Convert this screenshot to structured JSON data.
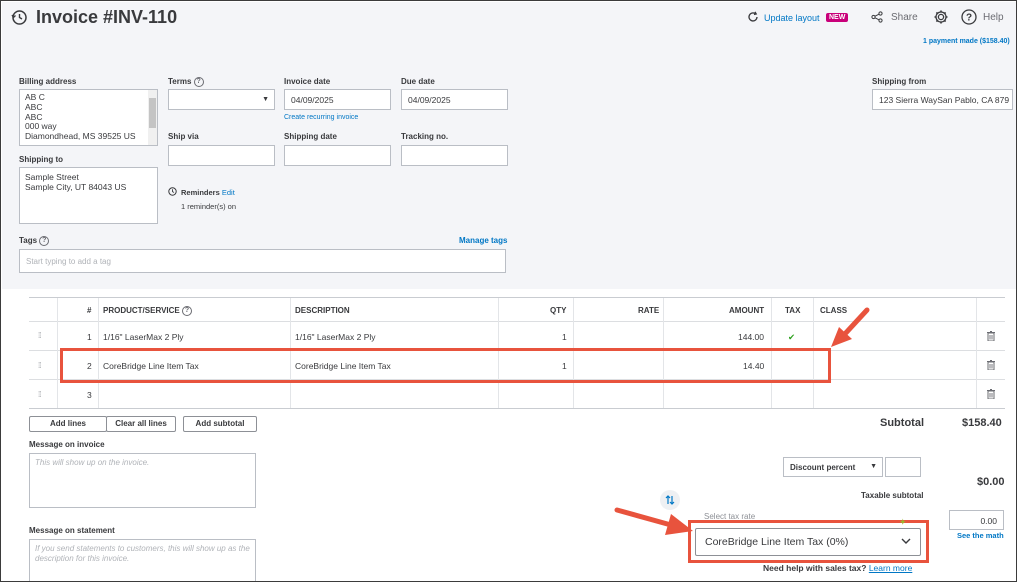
{
  "header": {
    "title": "Invoice #INV-110",
    "update_layout": "Update layout",
    "new_badge": "NEW",
    "share": "Share",
    "help": "Help",
    "payment_made": "1 payment made ($158.40)"
  },
  "form": {
    "billing_address_label": "Billing address",
    "billing_address_lines": [
      "AB C",
      "ABC",
      "ABC",
      "000 way",
      "Diamondhead, MS  39525 US"
    ],
    "terms_label": "Terms",
    "terms_value": "",
    "invoice_date_label": "Invoice date",
    "invoice_date_value": "04/09/2025",
    "create_recurring": "Create recurring invoice",
    "due_date_label": "Due date",
    "due_date_value": "04/09/2025",
    "shipping_from_label": "Shipping from",
    "shipping_from_value": "123 Sierra WaySan Pablo, CA  879",
    "ship_via_label": "Ship via",
    "shipping_date_label": "Shipping date",
    "tracking_label": "Tracking no.",
    "shipping_to_label": "Shipping to",
    "shipping_to_lines": [
      "Sample Street",
      "Sample City, UT  84043 US"
    ],
    "reminders_label": "Reminders",
    "reminders_edit": "Edit",
    "reminders_status": "1 reminder(s) on",
    "tags_label": "Tags",
    "manage_tags": "Manage tags",
    "tags_placeholder": "Start typing to add a tag"
  },
  "table": {
    "headers": {
      "num": "#",
      "product": "PRODUCT/SERVICE",
      "description": "DESCRIPTION",
      "qty": "QTY",
      "rate": "RATE",
      "amount": "AMOUNT",
      "tax": "TAX",
      "class": "CLASS"
    },
    "rows": [
      {
        "num": "1",
        "product": "1/16\" LaserMax 2 Ply",
        "description": "1/16\" LaserMax 2 Ply",
        "qty": "1",
        "rate": "",
        "amount": "144.00",
        "tax": "✔"
      },
      {
        "num": "2",
        "product": "CoreBridge Line Item Tax",
        "description": "CoreBridge Line Item Tax",
        "qty": "1",
        "rate": "",
        "amount": "14.40",
        "tax": ""
      },
      {
        "num": "3",
        "product": "",
        "description": "",
        "qty": "",
        "rate": "",
        "amount": "",
        "tax": ""
      }
    ]
  },
  "actions": {
    "add_lines": "Add lines",
    "clear_all_lines": "Clear all lines",
    "add_subtotal": "Add subtotal"
  },
  "summary": {
    "subtotal_label": "Subtotal",
    "subtotal_value": "$158.40",
    "discount_type": "Discount percent",
    "discount_value": "",
    "discount_amount": "$0.00",
    "taxable_subtotal_label": "Taxable subtotal",
    "select_tax_rate_label": "Select tax rate",
    "tax_rate_value": "CoreBridge Line Item Tax (0%)",
    "tax_amount": "0.00",
    "see_the_math": "See the math",
    "need_help": "Need help with sales tax?",
    "learn_more": "Learn more"
  },
  "messages": {
    "invoice_label": "Message on invoice",
    "invoice_placeholder": "This will show up on the invoice.",
    "statement_label": "Message on statement",
    "statement_placeholder": "If you send statements to customers, this will show up as the description for this invoice."
  },
  "colors": {
    "accent_link": "#0077c5",
    "annotation_red": "#e8533d",
    "new_badge": "#c9007a",
    "check_green": "#2ca01c"
  }
}
